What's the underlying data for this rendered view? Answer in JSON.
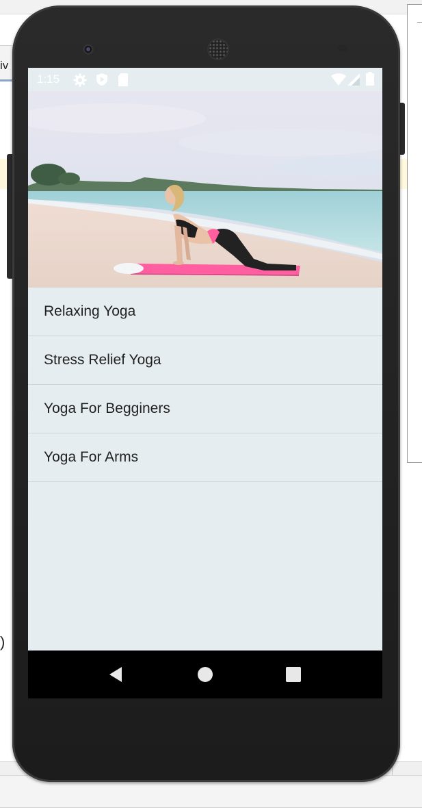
{
  "ide": {
    "tab_fragment": "iv",
    "paren_fragment": ")"
  },
  "status_bar": {
    "time": "1:15",
    "icons": [
      "settings-icon",
      "play-protect-icon",
      "sd-card-icon",
      "wifi-icon",
      "cellular-icon",
      "battery-icon"
    ]
  },
  "hero": {
    "image": "yoga-on-beach-photo"
  },
  "list": {
    "items": [
      {
        "label": "Relaxing Yoga"
      },
      {
        "label": "Stress Relief Yoga"
      },
      {
        "label": "Yoga For Begginers"
      },
      {
        "label": "Yoga For Arms"
      }
    ]
  },
  "nav": {
    "back": "back-icon",
    "home": "home-icon",
    "recents": "recents-icon"
  },
  "colors": {
    "screen_bg": "#e6edf0",
    "mat": "#ff5fa0",
    "navbar": "#000000"
  }
}
